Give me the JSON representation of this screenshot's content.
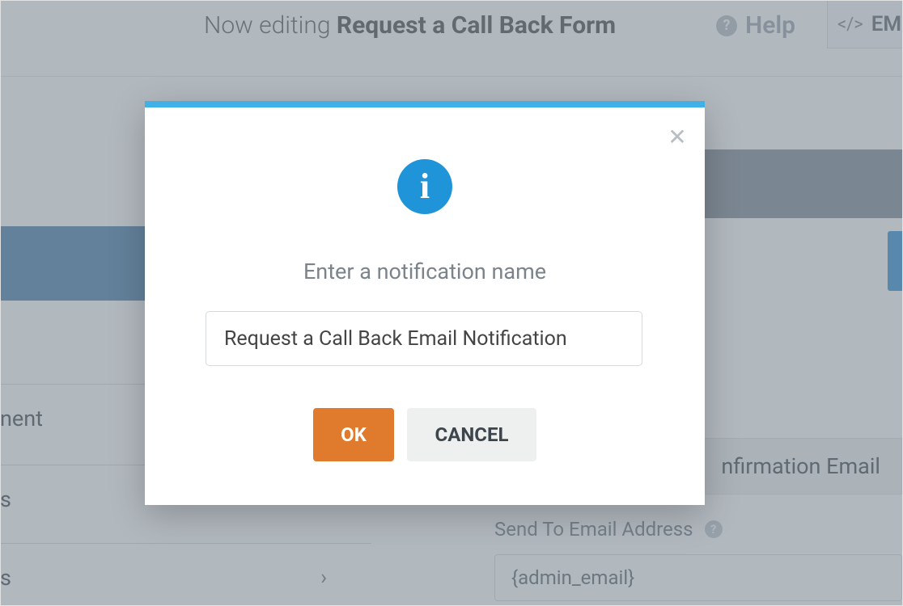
{
  "header": {
    "editing_prefix": "Now editing ",
    "form_name": "Request a Call Back Form",
    "help_label": "Help",
    "embed_label": "EM"
  },
  "sidebar": {
    "items": [
      {
        "label_fragment": "nent"
      },
      {
        "label_fragment": "s"
      },
      {
        "label_fragment": "s",
        "has_chevron": true
      }
    ]
  },
  "right_panel": {
    "confirmation_tab_fragment": "nfirmation Email",
    "send_to_label": "Send To Email Address",
    "send_to_value": "{admin_email}"
  },
  "modal": {
    "prompt": "Enter a notification name",
    "input_value": "Request a Call Back Email Notification",
    "ok_label": "OK",
    "cancel_label": "CANCEL"
  }
}
